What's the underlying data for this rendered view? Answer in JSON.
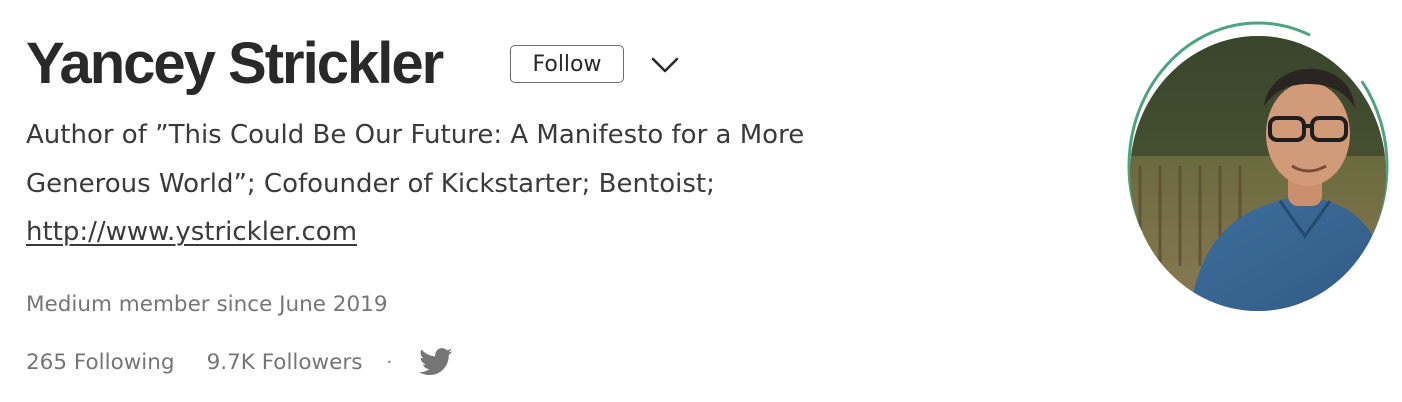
{
  "profile": {
    "name": "Yancey Strickler",
    "follow_label": "Follow",
    "bio": {
      "line1": "Author of ”This Could Be Our Future: A Manifesto for a More",
      "line2": "Generous World”; Cofounder of Kickstarter; Bentoist;",
      "link": "http://www.ystrickler.com"
    },
    "member_since": "Medium member since June 2019",
    "following": "265 Following",
    "followers": "9.7K Followers",
    "separator": "·",
    "social_icon": "twitter-icon",
    "avatar_icon": "avatar-photo",
    "colors": {
      "ring": "#4aa57e",
      "twitter": "#757575",
      "text": "#292929",
      "muted": "#757575"
    }
  }
}
